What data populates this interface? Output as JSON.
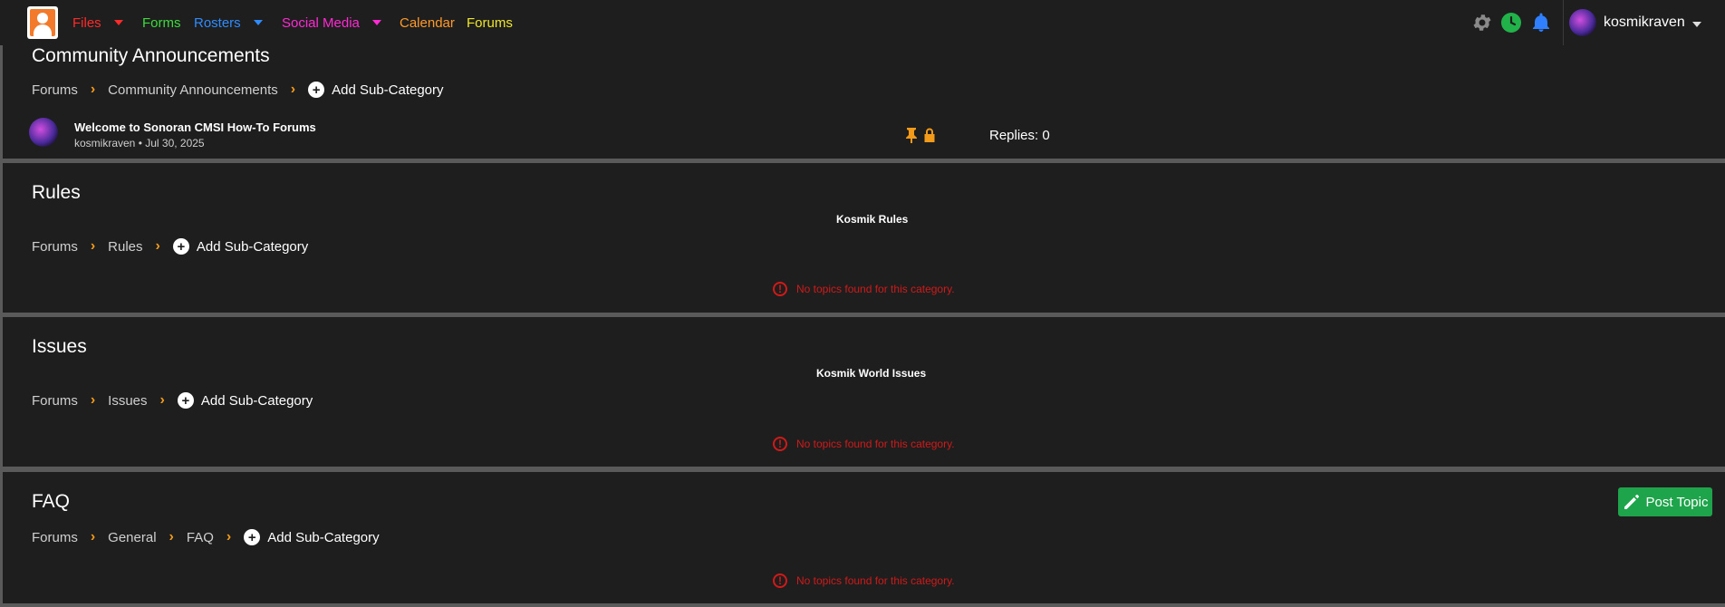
{
  "nav": {
    "items": [
      {
        "label": "Files",
        "color": "#ff2a2a",
        "caret": true,
        "caret_color": "#ff2a2a"
      },
      {
        "label": "Forms",
        "color": "#3cdc3c"
      },
      {
        "label": "Rosters",
        "color": "#2f8cff",
        "caret": true,
        "caret_color": "#2f8cff"
      },
      {
        "label": "Social Media",
        "color": "#ff2ad4",
        "caret": true,
        "caret_color": "#ff2ad4"
      },
      {
        "label": "Calendar",
        "color": "#ff9a2a"
      },
      {
        "label": "Forums",
        "color": "#f0e62a"
      }
    ],
    "icons": [
      "gear-icon",
      "clock-icon",
      "bell-icon"
    ],
    "user": {
      "name": "kosmikraven"
    }
  },
  "categories": [
    {
      "title": "Community Announcements",
      "breadcrumb": [
        "Forums",
        "Community Announcements"
      ],
      "add_label": "Add Sub-Category",
      "topic": {
        "title": "Welcome to Sonoran CMSI How-To Forums",
        "meta": "kosmikraven • Jul 30, 2025",
        "replies": "Replies: 0",
        "icons": [
          "pin-icon",
          "lock-icon"
        ]
      }
    },
    {
      "title": "Rules",
      "description": "Kosmik Rules",
      "breadcrumb": [
        "Forums",
        "Rules"
      ],
      "add_label": "Add Sub-Category",
      "empty": "No topics found for this category."
    },
    {
      "title": "Issues",
      "description": "Kosmik World Issues",
      "breadcrumb": [
        "Forums",
        "Issues"
      ],
      "add_label": "Add Sub-Category",
      "empty": "No topics found for this category."
    },
    {
      "title": "FAQ",
      "breadcrumb": [
        "Forums",
        "General",
        "FAQ"
      ],
      "add_label": "Add Sub-Category",
      "empty": "No topics found for this category.",
      "post_button": "Post Topic"
    }
  ],
  "colors": {
    "accent": "#f29a1a",
    "error": "#d01a1a",
    "post_button": "#1ea44a"
  }
}
